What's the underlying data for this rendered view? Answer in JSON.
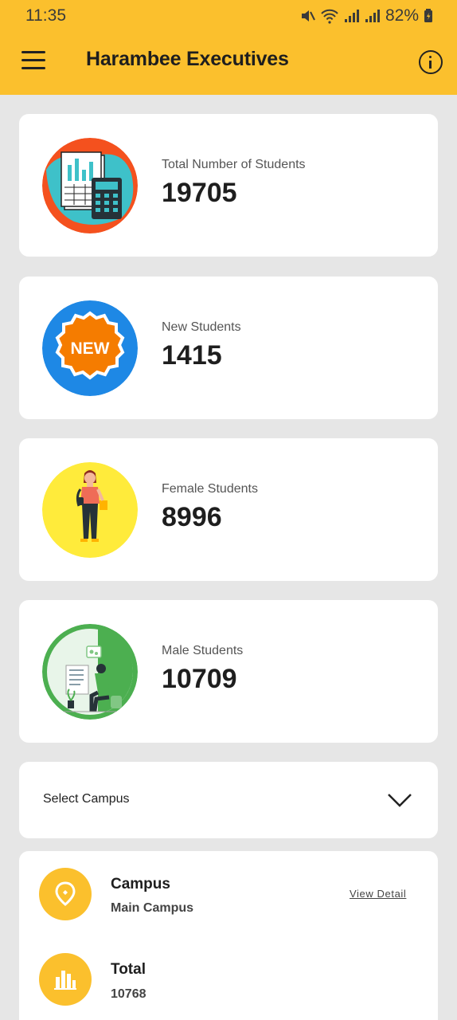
{
  "status_bar": {
    "time": "11:35",
    "battery": "82%"
  },
  "header": {
    "title": "Harambee Executives",
    "menu_icon": "hamburger-menu-icon",
    "info_icon": "info-icon",
    "color": "#fbc02d"
  },
  "stats": [
    {
      "label": "Total Number of Students",
      "value": "19705",
      "icon": "spreadsheet-calculator-icon"
    },
    {
      "label": "New Students",
      "value": "1415",
      "icon": "new-badge-icon",
      "badge_text": "NEW"
    },
    {
      "label": "Female Students",
      "value": "8996",
      "icon": "female-student-icon"
    },
    {
      "label": "Male Students",
      "value": "10709",
      "icon": "male-student-icon"
    }
  ],
  "campus_select": {
    "placeholder": "Select Campus",
    "icon": "chevron-down-icon"
  },
  "campus_detail": {
    "campus_label": "Campus",
    "campus_value": "Main Campus",
    "view_detail": "View Detail",
    "total_label": "Total",
    "total_value": "10768"
  }
}
